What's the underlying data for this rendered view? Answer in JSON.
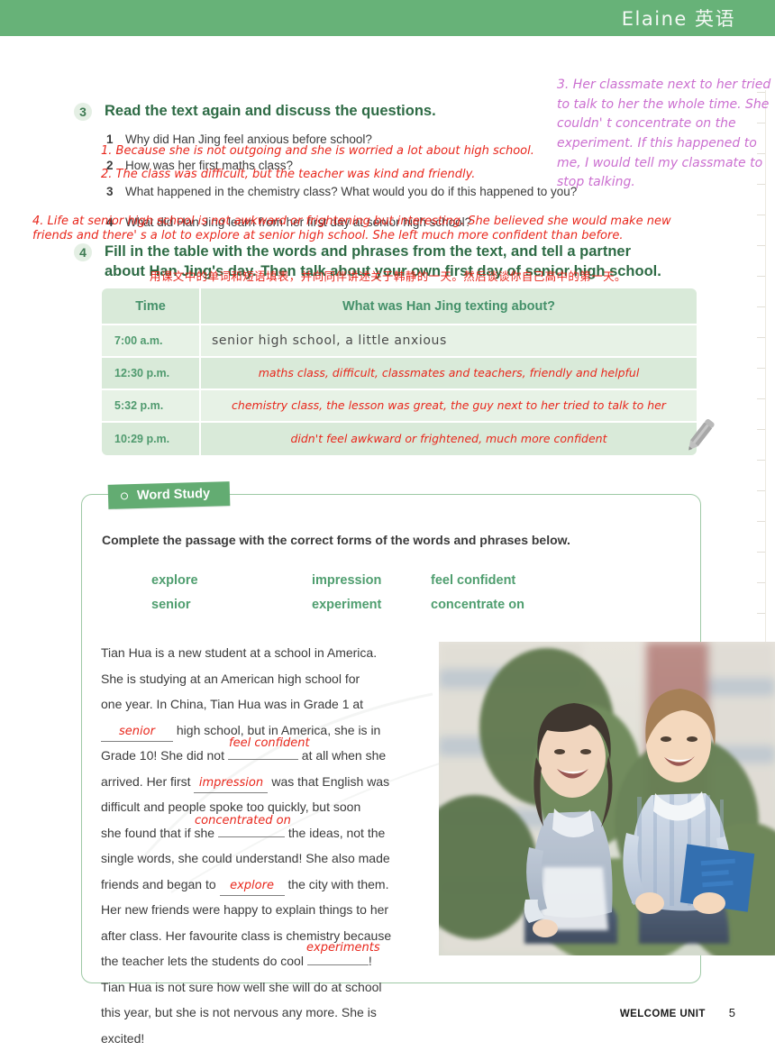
{
  "header": {
    "watermark": "Elaine 英语",
    "banner_color": "#67b278"
  },
  "exercise3": {
    "number": "3",
    "title": "Read the text again and discuss the questions.",
    "questions": [
      {
        "n": "1",
        "text": "Why did Han Jing feel anxious before school?"
      },
      {
        "n": "2",
        "text": "How was her first maths class?"
      },
      {
        "n": "3",
        "text": "What happened in the chemistry class? What would you do if this happened to you?"
      },
      {
        "n": "4",
        "text": "What did Han Jing learn from her first day at senior high school?"
      }
    ],
    "annotations": {
      "a1": "1. Because she is not outgoing and she is worried a lot about high school.",
      "a2": "2. The class was difficult,  but the teacher was kind and friendly.",
      "a4_line1": "4. Life at senior high school is not awkward or frightening but interesting. She believed she would make new",
      "a4_line2": "friends and there'  s a lot to explore at senior high school. She left much more confident than before.",
      "a3_right": "3. Her classmate next to her tried to talk to her the whole time. She couldn'  t concentrate on the experiment. If this happened to me,   I would tell my classmate to stop talking."
    },
    "annotation_color": "#e8271c",
    "annotation_color_right": "#cb6fd0"
  },
  "exercise4": {
    "number": "4",
    "title_line1": "Fill in the table with the words and phrases from the text, and tell a partner",
    "title_line2": "about Han Jing's day. Then talk about your own first day of senior high school.",
    "chinese_note": "用课文中的单词和短语填表，并向同伴讲述关于韩静的一天。然后谈谈你自己高中的第一天。",
    "table": {
      "headers": [
        "Time",
        "What was Han Jing texting about?"
      ],
      "rows": [
        {
          "time": "7:00 a.m.",
          "answer": "senior high school, a little anxious",
          "handwritten": false
        },
        {
          "time": "12:30 p.m.",
          "answer": "maths class,  difficult,  classmates and teachers,  friendly and helpful",
          "handwritten": true
        },
        {
          "time": "5:32 p.m.",
          "answer": "chemistry class,  the lesson was great,   the guy next to her tried to talk to her",
          "handwritten": true
        },
        {
          "time": "10:29 p.m.",
          "answer": "didn't feel awkward or frightened,  much more confident",
          "handwritten": true
        }
      ]
    }
  },
  "word_study": {
    "tab_label": "Word Study",
    "instruction": "Complete the passage with the correct forms of the words and phrases below.",
    "word_bank": [
      "explore",
      "impression",
      "feel confident",
      "senior",
      "experiment",
      "concentrate on"
    ],
    "word_color": "#4f9e6f",
    "passage_lines": [
      "Tian Hua is a new student at a school in America.",
      "She is studying at an American high school for",
      "one year. In China, Tian Hua was in Grade 1 at",
      "high school, but in America, she is in",
      "Grade 10! She did not",
      "at all when she",
      "arrived. Her first",
      "was that English was",
      "difficult and people spoke too quickly, but soon",
      "she found that if she",
      "the ideas, not the",
      "single words, she could understand! She also made",
      "friends and began to",
      "the city with them.",
      "Her new friends were happy to explain things to her",
      "after class. Her favourite class is chemistry because",
      "the teacher lets the students do cool",
      "Tian Hua is not sure how well she will do at school",
      "this year, but she is not nervous any more. She is",
      "excited!"
    ],
    "answers": {
      "blank1": "senior",
      "blank2": "feel confident",
      "blank3": "impression",
      "blank4": "concentrated on",
      "blank5": "explore",
      "blank6": "experiments"
    }
  },
  "photo": {
    "alt": "two students laughing outdoors on campus"
  },
  "footer": {
    "unit": "WELCOME UNIT",
    "page": "5"
  },
  "icons": {
    "pencil": "pencil-icon",
    "word_study_bullet": "circle-bullet-icon"
  }
}
